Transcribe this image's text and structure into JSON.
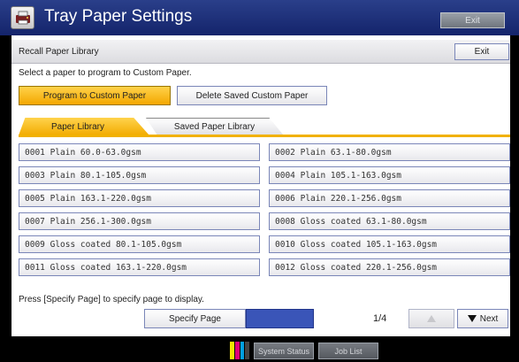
{
  "titlebar": {
    "icon": "printer-settings-icon",
    "title": "Tray Paper Settings",
    "exit_label": "Exit"
  },
  "header": {
    "title": "Recall Paper Library",
    "exit_label": "Exit"
  },
  "instruction": "Select a paper to program to Custom Paper.",
  "actions": {
    "program_label": "Program to Custom Paper",
    "delete_label": "Delete Saved Custom Paper"
  },
  "tabs": [
    {
      "label": "Paper Library",
      "selected": true
    },
    {
      "label": "Saved Paper Library",
      "selected": false
    }
  ],
  "papers": [
    "0001  Plain 60.0-63.0gsm",
    "0002  Plain 63.1-80.0gsm",
    "0003  Plain 80.1-105.0gsm",
    "0004  Plain 105.1-163.0gsm",
    "0005  Plain 163.1-220.0gsm",
    "0006  Plain 220.1-256.0gsm",
    "0007  Plain 256.1-300.0gsm",
    "0008  Gloss coated 63.1-80.0gsm",
    "0009  Gloss coated 80.1-105.0gsm",
    "0010  Gloss coated 105.1-163.0gsm",
    "0011  Gloss coated 163.1-220.0gsm",
    "0012  Gloss coated 220.1-256.0gsm"
  ],
  "footer": {
    "note": "Press [Specify Page] to specify page to display.",
    "specify_label": "Specify Page",
    "page_count": "1/4",
    "prev_icon": "triangle-up-icon",
    "next_label": "Next",
    "next_icon": "triangle-down-icon"
  },
  "bottombar": {
    "toner_colors": [
      "#f2e600",
      "#e0007a",
      "#00a0e0",
      "#222222"
    ],
    "toner_letters": [
      "Y",
      "M",
      "C",
      "K"
    ],
    "system_status_label": "System Status",
    "job_list_label": "Job List"
  },
  "colors": {
    "accent": "#f3a700",
    "titlebar": "#1c2e7a",
    "page_bar": "#3a55b8"
  }
}
